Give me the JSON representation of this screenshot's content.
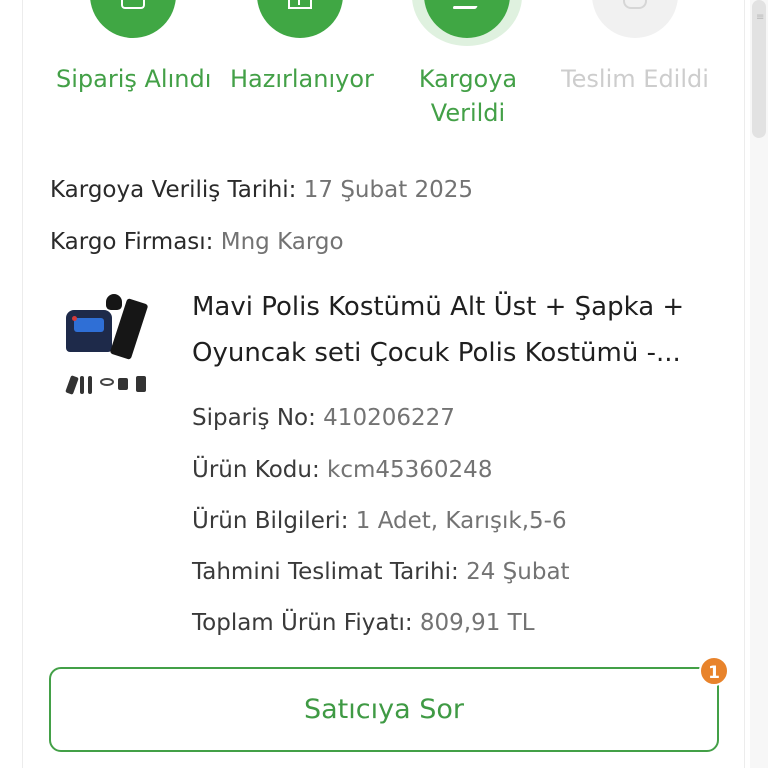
{
  "steps": [
    {
      "label": "Sipariş Alındı",
      "status": "done",
      "icon": "order-received-icon"
    },
    {
      "label": "Hazırlanıyor",
      "status": "done",
      "icon": "package-icon"
    },
    {
      "label": "Kargoya Verildi",
      "status": "active",
      "icon": "delivery-truck-icon"
    },
    {
      "label": "Teslim Edildi",
      "status": "pending",
      "icon": "delivered-check-icon"
    }
  ],
  "shipment": {
    "ship_date_label": "Kargoya Veriliş Tarihi:",
    "ship_date_value": "17 Şubat 2025",
    "carrier_label": "Kargo Firması:",
    "carrier_value": "Mng Kargo"
  },
  "product": {
    "title_line1": "Mavi Polis Kostümü Alt Üst + Şapka +",
    "title_line2": "Oyuncak seti Çocuk Polis Kostümü -...",
    "details": [
      {
        "label": "Sipariş No:",
        "value": "410206227"
      },
      {
        "label": "Ürün Kodu:",
        "value": "kcm45360248"
      },
      {
        "label": "Ürün Bilgileri:",
        "value": "1 Adet, Karışık,5-6"
      },
      {
        "label": "Tahmini Teslimat Tarihi:",
        "value": "24 Şubat"
      },
      {
        "label": "Toplam Ürün Fiyatı:",
        "value": "809,91 TL"
      }
    ]
  },
  "actions": {
    "ask_seller_label": "Satıcıya Sor",
    "badge_count": "1"
  },
  "colors": {
    "accent": "#43a047",
    "badge": "#e8832b",
    "pending": "#cdcdcd"
  }
}
